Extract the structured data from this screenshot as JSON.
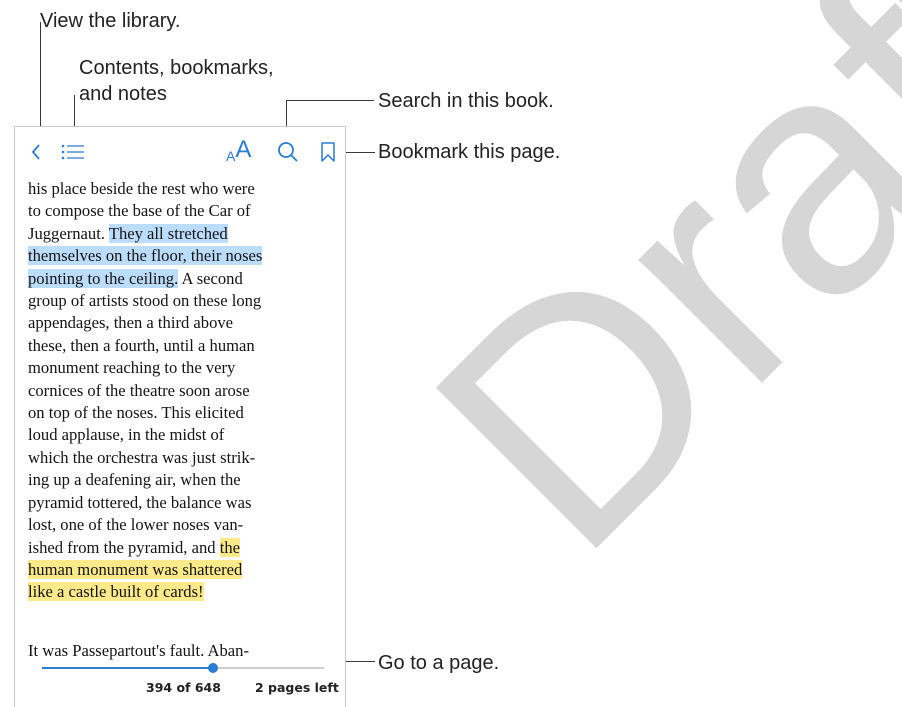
{
  "callouts": {
    "library": "View the library.",
    "contents_line1": "Contents, bookmarks,",
    "contents_line2": "and notes",
    "search": "Search in this book.",
    "bookmark": "Bookmark this page.",
    "goto": "Go to a page."
  },
  "toolbar": {
    "back_icon": "chevron-left-icon",
    "contents_icon": "list-icon",
    "text_size_small": "A",
    "text_size_large": "A",
    "search_icon": "search-icon",
    "bookmark_icon": "bookmark-icon",
    "accent_color": "#2b7cd3"
  },
  "page": {
    "lines": [
      "his place beside the rest who were",
      "to compose the base of the Car of",
      "Juggernaut. ",
      "They all stretched",
      "themselves on the floor, their noses",
      "pointing to the ceiling.",
      " A second",
      "group of artists stood on these long",
      "appendages, then a third above",
      "these, then a fourth, until a human",
      "monument reaching to the very",
      "cornices of the theatre soon arose",
      "on top of the noses. This elicited",
      "loud applause, in the midst of",
      "which the orchestra was just strik-",
      "ing up a deafening air, when the",
      "pyramid tottered, the balance was",
      "lost, one of the lower noses van-",
      "ished from the pyramid, and ",
      "the",
      "human monument was shattered",
      "like a castle built of cards!"
    ],
    "paragraph2": "It was Passepartout's fault. Aban-",
    "highlight_blue": "#bcdcfb",
    "highlight_yellow": "#fbe98a"
  },
  "scrubber": {
    "progress": 0.608,
    "current_page": "394 of 648",
    "pages_left": "2 pages left"
  },
  "watermark": "Draft"
}
